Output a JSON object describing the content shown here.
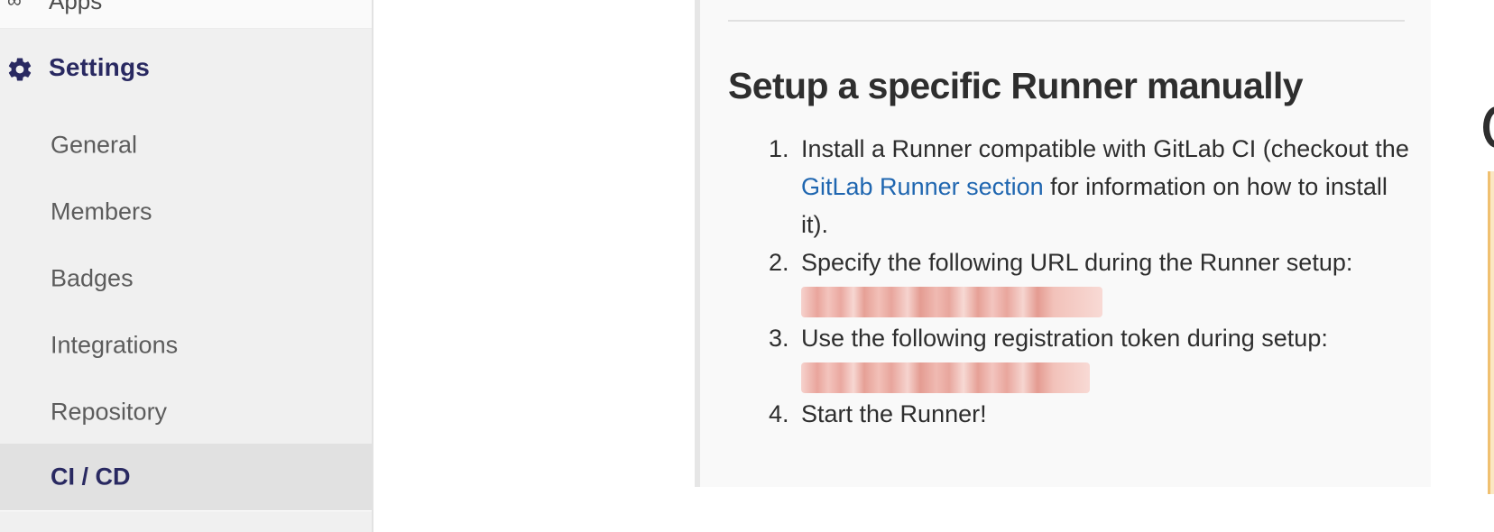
{
  "sidebar": {
    "previous_item_label": "Apps",
    "settings": {
      "label": "Settings",
      "icon": "gear-icon",
      "accent_color": "#292961"
    },
    "items": [
      {
        "label": "General",
        "active": false
      },
      {
        "label": "Members",
        "active": false
      },
      {
        "label": "Badges",
        "active": false
      },
      {
        "label": "Integrations",
        "active": false
      },
      {
        "label": "Repository",
        "active": false
      },
      {
        "label": "CI / CD",
        "active": true
      }
    ]
  },
  "main": {
    "title": "Setup a specific Runner manually",
    "steps": [
      {
        "number": "1.",
        "text_before_link": "Install a Runner compatible with GitLab CI (checkout the ",
        "link_text": "GitLab Runner section",
        "text_after_link": " for information on how to install it)."
      },
      {
        "number": "2.",
        "text": "Specify the following URL during the Runner setup:",
        "redacted_value": "url"
      },
      {
        "number": "3.",
        "text": "Use the following registration token during setup:",
        "redacted_value": "token"
      },
      {
        "number": "4.",
        "text": "Start the Runner!"
      }
    ],
    "link_color": "#1f66b0"
  }
}
